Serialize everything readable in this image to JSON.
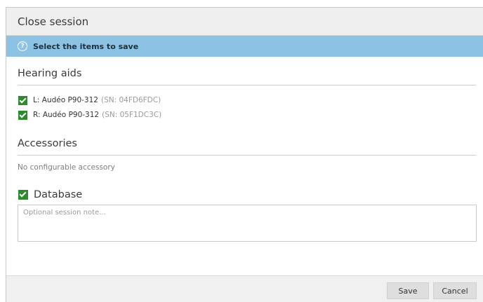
{
  "dialog": {
    "title": "Close session"
  },
  "banner": {
    "icon": "question-circle-icon",
    "text": "Select the items to save"
  },
  "hearing_aids": {
    "title": "Hearing aids",
    "items": [
      {
        "label": "L: Audéo P90-312",
        "serial": "(SN: 04FD6FDC)",
        "checked": true
      },
      {
        "label": "R: Audéo P90-312",
        "serial": "(SN: 05F1DC3C)",
        "checked": true
      }
    ]
  },
  "accessories": {
    "title": "Accessories",
    "empty_text": "No configurable accessory"
  },
  "database": {
    "label": "Database",
    "checked": true,
    "note_placeholder": "Optional session note...",
    "note_value": ""
  },
  "footer": {
    "save_label": "Save",
    "cancel_label": "Cancel"
  },
  "colors": {
    "banner": "#8cc2e3",
    "checkbox": "#2f8a2f",
    "section_rule": "#b9dfa2"
  }
}
